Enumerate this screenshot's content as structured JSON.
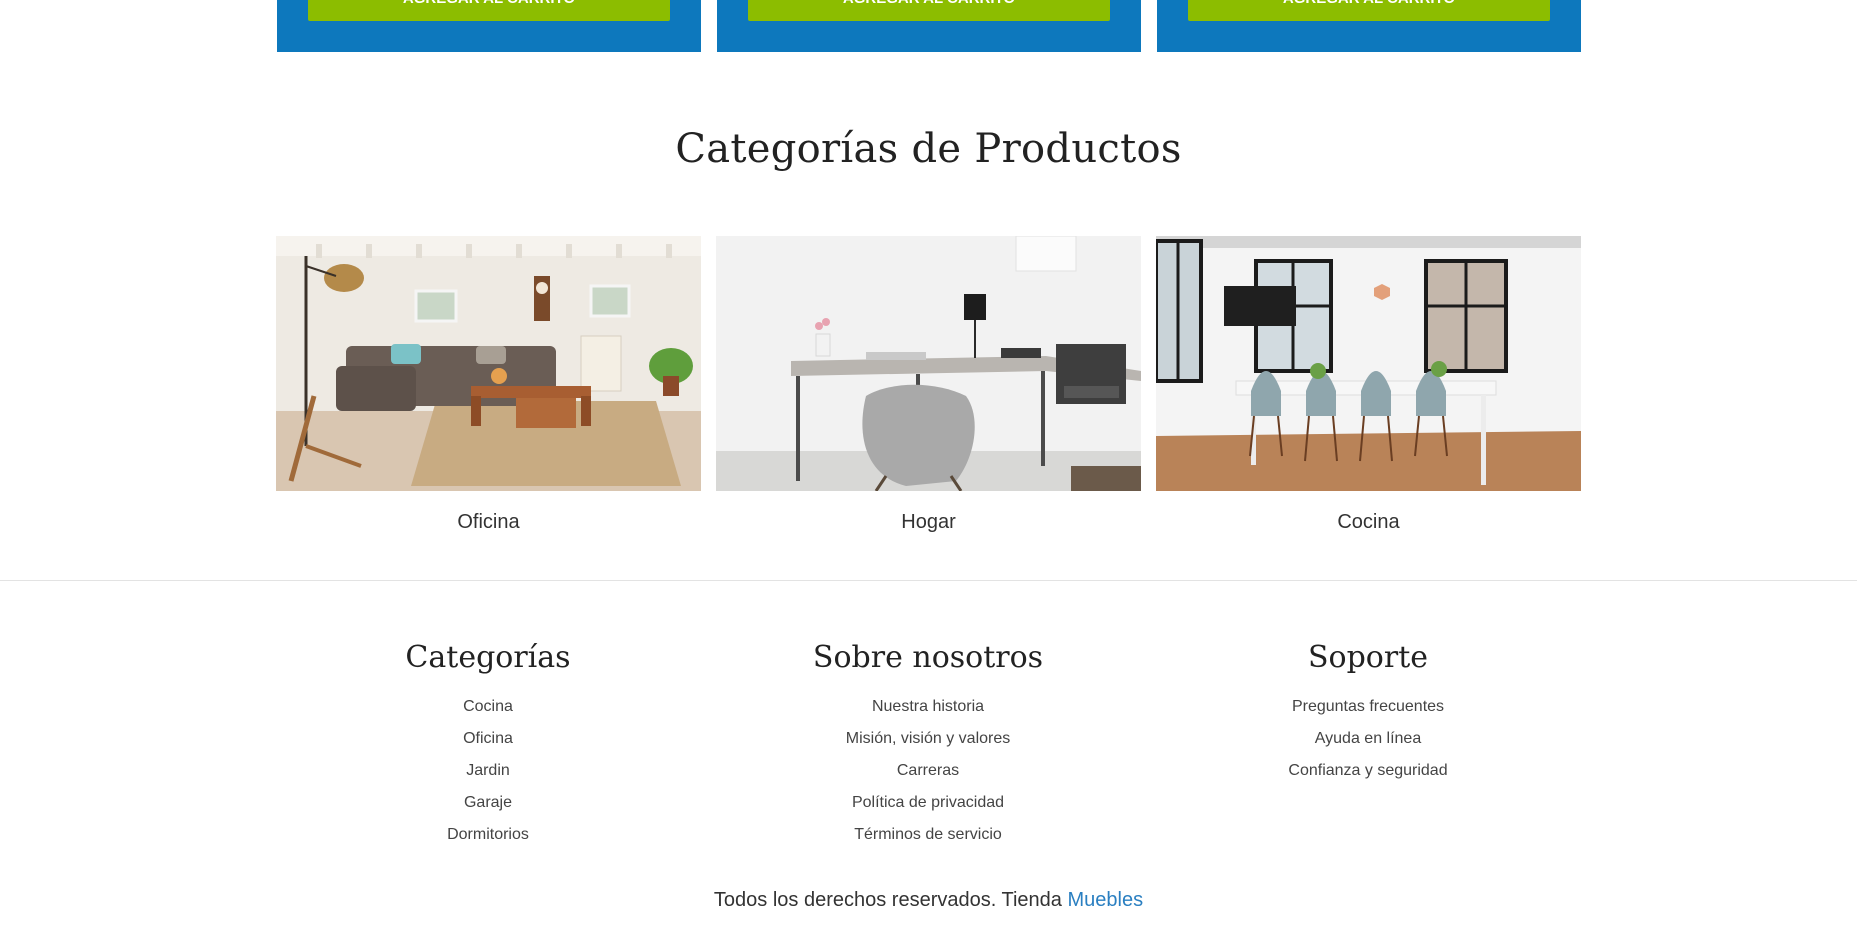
{
  "products": [
    {
      "button_label": "Agregar al carrito"
    },
    {
      "button_label": "Agregar al carrito"
    },
    {
      "button_label": "Agregar al carrito"
    }
  ],
  "categories_section": {
    "title": "Categorías de Productos",
    "items": [
      {
        "label": "Oficina",
        "image": "living-room-photo"
      },
      {
        "label": "Hogar",
        "image": "desk-workspace-photo"
      },
      {
        "label": "Cocina",
        "image": "dining-room-photo"
      }
    ]
  },
  "footer": {
    "columns": [
      {
        "title": "Categorías",
        "links": [
          "Cocina",
          "Oficina",
          "Jardin",
          "Garaje",
          "Dormitorios"
        ]
      },
      {
        "title": "Sobre nosotros",
        "links": [
          "Nuestra historia",
          "Misión, visión y valores",
          "Carreras",
          "Política de privacidad",
          "Términos de servicio"
        ]
      },
      {
        "title": "Soporte",
        "links": [
          "Preguntas frecuentes",
          "Ayuda en línea",
          "Confianza y seguridad"
        ]
      }
    ],
    "copyright_text": "Todos los derechos reservados. Tienda",
    "copyright_link": "Muebles"
  },
  "colors": {
    "card_blue": "#0d78bd",
    "button_green": "#8cbd00",
    "link_blue": "#2a7fc1"
  }
}
